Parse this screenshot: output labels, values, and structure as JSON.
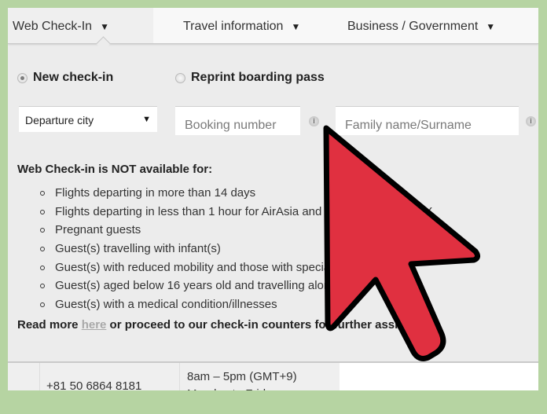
{
  "nav": {
    "tabs": [
      {
        "label": "Web Check-In",
        "active": true
      },
      {
        "label": "Travel information",
        "active": false
      },
      {
        "label": "Business / Government",
        "active": false
      }
    ],
    "caret_icon": "▼"
  },
  "checkin_type": {
    "options": [
      {
        "label": "New check-in",
        "checked": true
      },
      {
        "label": "Reprint boarding pass",
        "checked": false
      }
    ]
  },
  "form": {
    "departure_city": {
      "value": "Departure city",
      "caret_icon": "▼"
    },
    "booking_number": {
      "placeholder": "Booking number",
      "value": ""
    },
    "family_name": {
      "placeholder": "Family name/Surname",
      "value": ""
    },
    "info_icon": "i"
  },
  "notice": {
    "heading": "Web Check-in is NOT available for:",
    "items": [
      "Flights departing in more than 14 days",
      "Flights departing in less than 1 hour for AirAsia and 4 hours for AirAsia X",
      "Pregnant guests",
      "Guest(s) travelling with infant(s)",
      "Guest(s) with reduced mobility and those with special needs",
      "Guest(s) aged below 16 years old and travelling alone",
      "Guest(s) with a medical condition/illnesses"
    ],
    "read_more_prefix": "Read more ",
    "read_more_link": "here",
    "read_more_suffix": " or proceed to our check-in counters for further assistance."
  },
  "contact_row": {
    "phone": "+81 50 6864 8181",
    "hours_line1": "8am – 5pm (GMT+9)",
    "hours_line2": "Monday to Friday"
  },
  "annotation": {
    "cursor_icon": "red-arrow-pointer",
    "cursor_color": "#e03040"
  }
}
